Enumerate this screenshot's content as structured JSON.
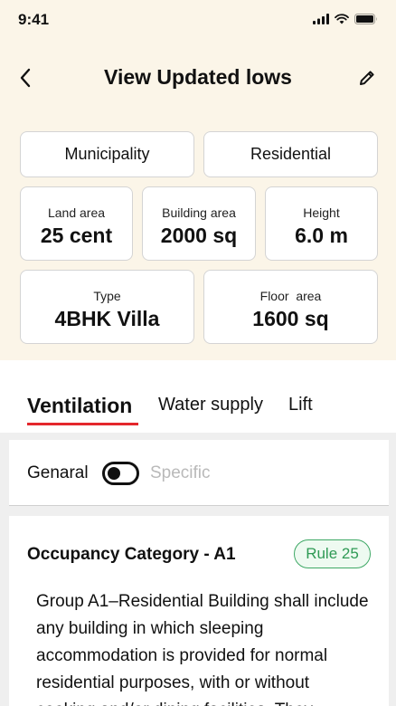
{
  "status_bar": {
    "time": "9:41"
  },
  "header": {
    "title": "View Updated lows"
  },
  "tags": [
    "Municipality",
    "Residential"
  ],
  "stats_row1": [
    {
      "label": "Land area",
      "value": "25 cent"
    },
    {
      "label": "Building area",
      "value": "2000 sq"
    },
    {
      "label": "Height",
      "value": "6.0 m"
    }
  ],
  "stats_row2": [
    {
      "label": "Type",
      "value": "4BHK Villa"
    },
    {
      "label": "Floor  area",
      "value": "1600 sq"
    }
  ],
  "tabs": [
    {
      "label": "Ventilation",
      "active": true
    },
    {
      "label": "Water supply",
      "active": false
    },
    {
      "label": "Lift",
      "active": false
    }
  ],
  "toggle": {
    "left_label": "Genaral",
    "right_label": "Specific",
    "state": "Genaral"
  },
  "rule": {
    "title": "Occupancy Category - A1",
    "badge": "Rule 25",
    "description": "Group A1–Residential Building shall include any building in which sleeping accommodation is provided for normal residential purposes, with or without cooking and/or dining facilities. They"
  },
  "colors": {
    "header_background": "#fbf5e8",
    "accent_red": "#e4262c",
    "rule_green": "#2f9a55"
  }
}
